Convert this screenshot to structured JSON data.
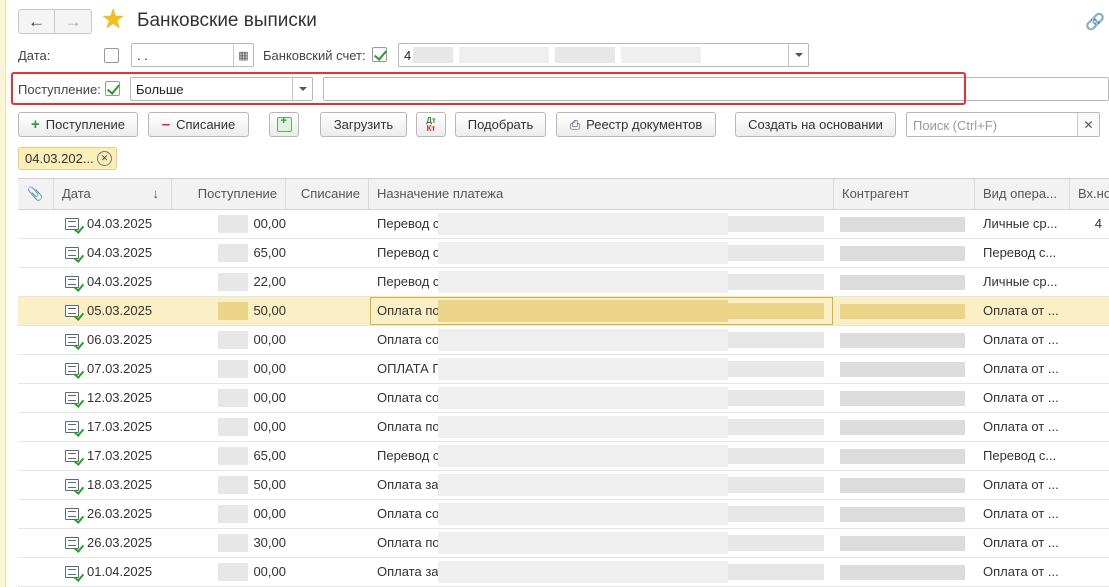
{
  "window": {
    "title": "Банковские выписки",
    "nav": {
      "back_icon": "arrow-left-icon",
      "forward_icon": "arrow-right-icon"
    },
    "favorite_icon": "star-icon",
    "link_icon": "link-icon"
  },
  "filters": {
    "date_label": "Дата:",
    "date_checked": false,
    "date_value": " .  .",
    "account_label": "Банковский счет:",
    "account_checked": true,
    "account_value": "4",
    "income_label": "Поступление:",
    "income_checked": true,
    "income_condition": "Больше",
    "income_value": ""
  },
  "toolbar": {
    "income_button": "Поступление",
    "expense_button": "Списание",
    "load_button": "Загрузить",
    "match_button": "Подобрать",
    "registry_button": "Реестр документов",
    "create_based_button": "Создать на основании",
    "search_placeholder": "Поиск (Ctrl+F)"
  },
  "active_filter_chip": "04.03.202...",
  "table": {
    "columns": [
      "Дата",
      "Поступление",
      "Списание",
      "Назначение платежа",
      "Контрагент",
      "Вид опера...",
      "Вх.но"
    ],
    "rows": [
      {
        "date": "04.03.2025",
        "income": "00,00",
        "purpose": "Перевод с",
        "operation": "Личные ср...",
        "extra": "4"
      },
      {
        "date": "04.03.2025",
        "income": "65,00",
        "purpose": "Перевод с",
        "operation": "Перевод с...",
        "extra": ""
      },
      {
        "date": "04.03.2025",
        "income": "22,00",
        "purpose": "Перевод с",
        "operation": "Личные ср...",
        "extra": ""
      },
      {
        "date": "05.03.2025",
        "income": "50,00",
        "purpose": "Оплата по",
        "operation": "Оплата от ...",
        "extra": "",
        "selected": true
      },
      {
        "date": "06.03.2025",
        "income": "00,00",
        "purpose": "Оплата со",
        "operation": "Оплата от ...",
        "extra": ""
      },
      {
        "date": "07.03.2025",
        "income": "00,00",
        "purpose": "ОПЛАТА П",
        "operation": "Оплата от ...",
        "extra": ""
      },
      {
        "date": "12.03.2025",
        "income": "00,00",
        "purpose": "Оплата со",
        "operation": "Оплата от ...",
        "extra": ""
      },
      {
        "date": "17.03.2025",
        "income": "00,00",
        "purpose": "Оплата по",
        "operation": "Оплата от ...",
        "extra": ""
      },
      {
        "date": "17.03.2025",
        "income": "65,00",
        "purpose": "Перевод с",
        "operation": "Перевод с...",
        "extra": ""
      },
      {
        "date": "18.03.2025",
        "income": "50,00",
        "purpose": "Оплата за",
        "operation": "Оплата от ...",
        "extra": ""
      },
      {
        "date": "26.03.2025",
        "income": "00,00",
        "purpose": "Оплата со",
        "operation": "Оплата от ...",
        "extra": ""
      },
      {
        "date": "26.03.2025",
        "income": "30,00",
        "purpose": "Оплата по",
        "operation": "Оплата от ...",
        "extra": ""
      },
      {
        "date": "01.04.2025",
        "income": "00,00",
        "purpose": "Оплата за",
        "operation": "Оплата от ...",
        "extra": ""
      }
    ]
  },
  "colors": {
    "accent_star": "#f2c01b",
    "selection": "#fbf0c5",
    "highlight_frame": "#e03535",
    "check": "#22a025"
  }
}
